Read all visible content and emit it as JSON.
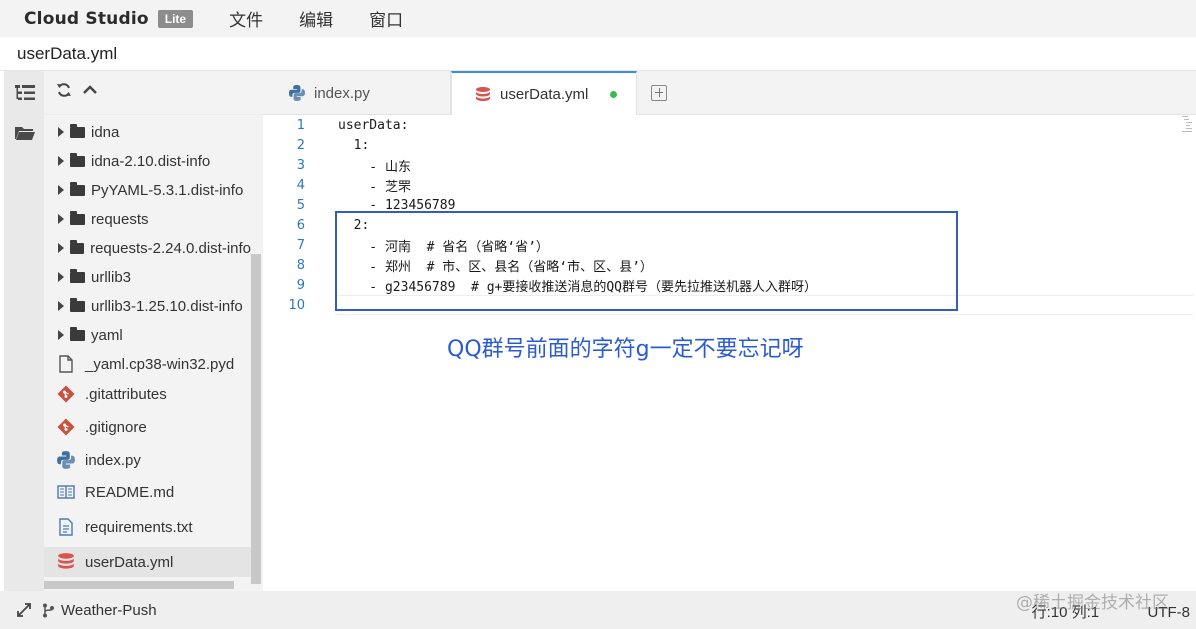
{
  "app": {
    "brand": "Cloud Studio",
    "badge": "Lite",
    "menu": [
      "文件",
      "编辑",
      "窗口"
    ],
    "file_title": "userData.yml"
  },
  "sidebar": {
    "items": [
      {
        "label": "idna",
        "type": "folder"
      },
      {
        "label": "idna-2.10.dist-info",
        "type": "folder"
      },
      {
        "label": "PyYAML-5.3.1.dist-info",
        "type": "folder"
      },
      {
        "label": "requests",
        "type": "folder"
      },
      {
        "label": "requests-2.24.0.dist-info",
        "type": "folder"
      },
      {
        "label": "urllib3",
        "type": "folder"
      },
      {
        "label": "urllib3-1.25.10.dist-info",
        "type": "folder"
      },
      {
        "label": "yaml",
        "type": "folder"
      },
      {
        "label": "_yaml.cp38-win32.pyd",
        "type": "file"
      },
      {
        "label": ".gitattributes",
        "type": "git"
      },
      {
        "label": ".gitignore",
        "type": "git"
      },
      {
        "label": "index.py",
        "type": "python"
      },
      {
        "label": "README.md",
        "type": "book"
      },
      {
        "label": "requirements.txt",
        "type": "text"
      },
      {
        "label": "userData.yml",
        "type": "database"
      }
    ]
  },
  "tabs": [
    {
      "label": "index.py",
      "icon": "python-icon"
    },
    {
      "label": "userData.yml",
      "icon": "database-icon",
      "modified": true
    }
  ],
  "editor": {
    "lines": [
      {
        "n": "1",
        "text": "userData:"
      },
      {
        "n": "2",
        "text": "  1:"
      },
      {
        "n": "3",
        "text": "    - 山东"
      },
      {
        "n": "4",
        "text": "    - 芝罘"
      },
      {
        "n": "5",
        "text": "    - 123456789"
      },
      {
        "n": "6",
        "text": "  2:"
      },
      {
        "n": "7",
        "text": "    - 河南  # 省名（省略‘省’）"
      },
      {
        "n": "8",
        "text": "    - 郑州  # 市、区、县名（省略‘市、区、县’）"
      },
      {
        "n": "9",
        "text": "    - g23456789  # g+要接收推送消息的QQ群号（要先拉推送机器人入群呀）"
      },
      {
        "n": "10",
        "text": ""
      }
    ],
    "annotation": "QQ群号前面的字符g一定不要忘记呀"
  },
  "status": {
    "project": "Weather-Push",
    "position": "行:10 列:1",
    "encoding": "UTF-8",
    "watermark": "@稀土掘金技术社区"
  },
  "colors": {
    "accent": "#3b8ddd",
    "annotation": "#2a5bd0",
    "highlight_border": "#2f5fb8",
    "modified_dot": "#3cba54"
  }
}
